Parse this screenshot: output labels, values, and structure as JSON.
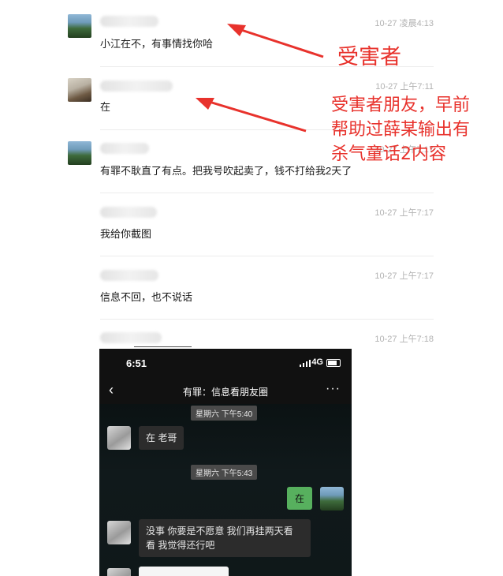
{
  "messages": [
    {
      "time": "10-27 凌晨4:13",
      "text": "小江在不，有事情找你哈",
      "avatar": "landscape"
    },
    {
      "time": "10-27 上午7:11",
      "text": "在",
      "avatar": "person"
    },
    {
      "time": "10-27 上午7:17",
      "text": "有罪不耿直了有点。把我号吹起卖了，钱不打给我2天了",
      "avatar": "landscape"
    },
    {
      "time": "10-27 上午7:17",
      "text": "我给你截图",
      "avatar": "none"
    },
    {
      "time": "10-27 上午7:17",
      "text": "信息不回，也不说话",
      "avatar": "none"
    },
    {
      "time": "10-27 上午7:18",
      "text": "",
      "avatar": "none"
    }
  ],
  "annotations": {
    "victim": "受害者",
    "friend_line1": "受害者朋友，早前",
    "friend_line2": "帮助过薛某输出有",
    "friend_line3": "杀气童话2内容",
    "color": "#e8322c"
  },
  "phone": {
    "clock": "6:51",
    "network": "4G",
    "chat_title": "有罪：信息看朋友圈",
    "back_icon": "chevron-left-icon",
    "more_icon": "ellipsis-icon",
    "messages": [
      {
        "type": "time",
        "text": "星期六 下午5:40"
      },
      {
        "type": "left",
        "text": "在 老哥"
      },
      {
        "type": "time",
        "text": "星期六 下午5:43"
      },
      {
        "type": "right",
        "text": "在"
      },
      {
        "type": "left",
        "line1": "没事 你要是不愿意 我们再挂两天看",
        "line2": "看  我觉得还行吧"
      }
    ]
  }
}
